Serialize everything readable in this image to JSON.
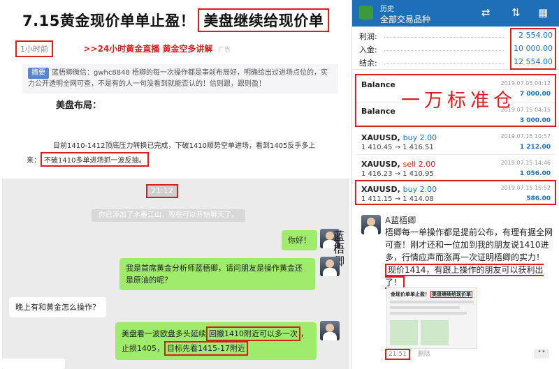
{
  "article": {
    "title_main": "7.15黄金现价单单止盈！",
    "title_boxed": "美盘继续给现价单",
    "time_ago": "1小时前",
    "live_promo": ">>24小时黄金直播 黄金空多讲解",
    "ad_tag": "广告",
    "summary_tag": "摘要",
    "summary_text": "蓝梧卿微信：gwhc8848 梧卿的每一次操作都是事前布局好，明确给出过进场点位的，实力公开透明全网可查，不是有的人一句没看到就能否认的！信则跟，跟则盈！",
    "subhead": "美盘布局：",
    "body_line1": "目前1410-1412顶底压力转换已完成，下破1410顺势空单进场，看到1405反手多上",
    "body_line2_prefix": "来：",
    "body_line2_boxed": "不破1410多单进场抓一波反抽。"
  },
  "chat": {
    "timestamp": "21:12",
    "system_msg": "你已添加了水墨江山，现在可以开始聊天了。",
    "vertical_name": "蓝梧卿",
    "messages": {
      "m1": "你好！",
      "m2": "我是首席黄金分析师蓝梧卿，请问朋友是操作黄金还是原油的呢？",
      "m3": "晚上有和黄金怎么操作？",
      "m4_a": "美盘看一波欧盘多头延续",
      "m4_b": "回撤1410附近可以多一次",
      "m4_c": "，止损1405，",
      "m4_d": "目标先看1415-17附近"
    }
  },
  "phone": {
    "header_small": "历史",
    "header_title": "全部交易品种",
    "icons": [
      "currency-exchange-icon",
      "sort-icon",
      "calendar-icon"
    ],
    "summary": [
      {
        "label": "利润:",
        "value": "2 554.00"
      },
      {
        "label": "入金:",
        "value": "10 000.00"
      },
      {
        "label": "结余:",
        "value": "12 554.00"
      }
    ],
    "big_label": "一万标准仓",
    "deals": [
      {
        "symbol": "Balance",
        "side": "",
        "prices": "",
        "date": "2019.07.05 04:12",
        "amount": "7 000.00"
      },
      {
        "symbol": "Balance",
        "side": "",
        "prices": "",
        "date": "2019.07.15 04:15",
        "amount": "3 000.00"
      },
      {
        "symbol": "XAUUSD,",
        "side": "buy 2.00",
        "prices": "1 410.45 → 1 416.51",
        "date": "2019.07.15 10:57",
        "amount": "1 212.00"
      },
      {
        "symbol": "XAUUSD,",
        "side": "sell 2.00",
        "prices": "1 416.23 → 1 410.95",
        "date": "2019.07.15 14:46",
        "amount": "1 056.00"
      },
      {
        "symbol": "XAUUSD,",
        "side": "buy 2.00",
        "prices": "1 411.15 → 1 414.08",
        "date": "2019.07.15 15:52",
        "amount": "586.00"
      }
    ],
    "post": {
      "name": "A蓝梧卿",
      "text_a": "梧卿每一单操作都是提前公布，有理有据全网可查！刚才还和一位加到我的朋友说1410进多，行情应声而涨再一次证明梧卿的实力！",
      "text_boxed": "现价1414，有跟上操作的朋友可以获利出了！",
      "thumb_title_a": "金现价单单止盈！",
      "thumb_title_boxed": "美盘继续给现价单",
      "time": "21:51",
      "delete": "删除",
      "more": "••"
    }
  }
}
